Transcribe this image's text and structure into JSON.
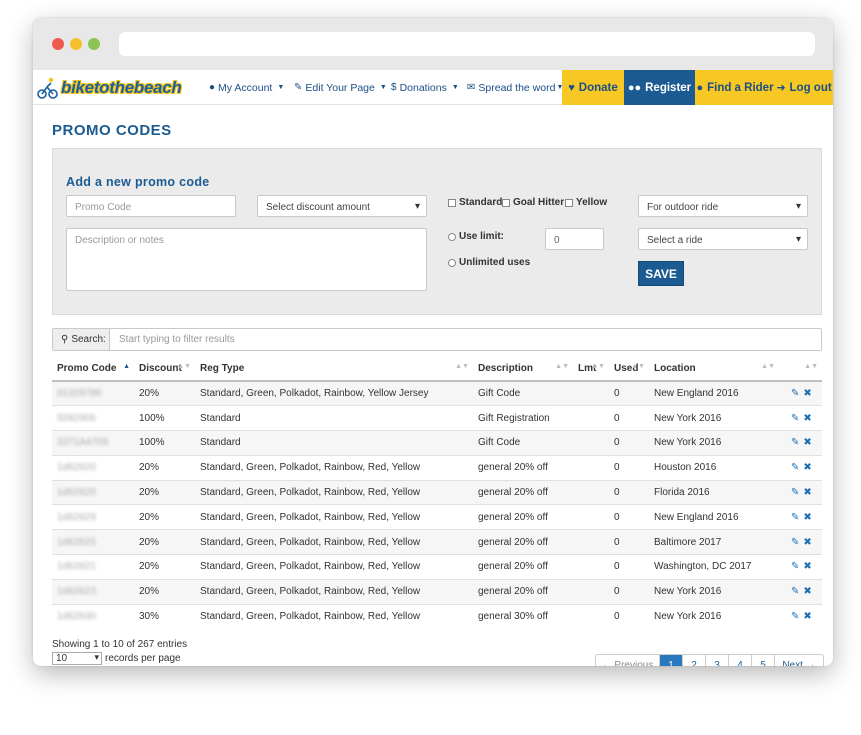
{
  "nav": {
    "logo_text": "biketothebeach",
    "menu": [
      {
        "label": "My Account",
        "icon": "user-icon"
      },
      {
        "label": "Edit Your Page",
        "icon": "edit-icon"
      },
      {
        "label": "Donations",
        "icon": "dollar-icon"
      },
      {
        "label": "Spread the word",
        "icon": "envelope-icon"
      }
    ],
    "donate_label": "Donate",
    "register_label": "Register",
    "find_rider_label": "Find a Rider",
    "logout_label": "Log out",
    "colors": {
      "brand_blue": "#1b5b92",
      "accent_yellow": "#f7c723"
    }
  },
  "page": {
    "title": "PROMO CODES"
  },
  "form": {
    "title": "Add a new promo code",
    "promo_placeholder": "Promo Code",
    "discount_select": "Select discount amount",
    "description_placeholder": "Description or notes",
    "checkbox_standard": "Standard",
    "checkbox_goal": "Goal Hitter",
    "checkbox_yellow": "Yellow",
    "use_limit_label": "Use limit:",
    "use_limit_value": "0",
    "unlimited_label": "Unlimited uses",
    "ride_type_select": "For outdoor ride",
    "ride_select": "Select a ride",
    "save_label": "SAVE"
  },
  "search": {
    "label": "Search:",
    "placeholder": "Start typing to filter results"
  },
  "table": {
    "headers": [
      "Promo Code",
      "Discount",
      "Reg Type",
      "Description",
      "Lmt",
      "Used",
      "Location"
    ],
    "rows": [
      {
        "code": "01329786",
        "discount": "20%",
        "reg_type": "Standard, Green, Polkadot, Rainbow, Yellow Jersey",
        "description": "Gift Code",
        "lmt": "",
        "used": "0",
        "location": "New England 2016"
      },
      {
        "code": "5092906",
        "discount": "100%",
        "reg_type": "Standard",
        "description": "Gift Registration",
        "lmt": "",
        "used": "0",
        "location": "New York 2016"
      },
      {
        "code": "3371A4709",
        "discount": "100%",
        "reg_type": "Standard",
        "description": "Gift Code",
        "lmt": "",
        "used": "0",
        "location": "New York 2016"
      },
      {
        "code": "1d62620",
        "discount": "20%",
        "reg_type": "Standard, Green, Polkadot, Rainbow, Red, Yellow",
        "description": "general 20% off",
        "lmt": "",
        "used": "0",
        "location": "Houston 2016"
      },
      {
        "code": "1d62620",
        "discount": "20%",
        "reg_type": "Standard, Green, Polkadot, Rainbow, Red, Yellow",
        "description": "general 20% off",
        "lmt": "",
        "used": "0",
        "location": "Florida 2016"
      },
      {
        "code": "1d62629",
        "discount": "20%",
        "reg_type": "Standard, Green, Polkadot, Rainbow, Red, Yellow",
        "description": "general 20% off",
        "lmt": "",
        "used": "0",
        "location": "New England 2016"
      },
      {
        "code": "1d62625",
        "discount": "20%",
        "reg_type": "Standard, Green, Polkadot, Rainbow, Red, Yellow",
        "description": "general 20% off",
        "lmt": "",
        "used": "0",
        "location": "Baltimore 2017"
      },
      {
        "code": "1d62621",
        "discount": "20%",
        "reg_type": "Standard, Green, Polkadot, Rainbow, Red, Yellow",
        "description": "general 20% off",
        "lmt": "",
        "used": "0",
        "location": "Washington, DC 2017"
      },
      {
        "code": "1d62623",
        "discount": "20%",
        "reg_type": "Standard, Green, Polkadot, Rainbow, Red, Yellow",
        "description": "general 20% off",
        "lmt": "",
        "used": "0",
        "location": "New York 2016"
      },
      {
        "code": "1d62630",
        "discount": "30%",
        "reg_type": "Standard, Green, Polkadot, Rainbow, Red, Yellow",
        "description": "general 30% off",
        "lmt": "",
        "used": "0",
        "location": "New York 2016"
      }
    ]
  },
  "footer": {
    "info": "Showing 1 to 10 of 267 entries",
    "per_page_value": "10",
    "per_page_label": "records per page"
  },
  "pagination": {
    "prev": "← Previous",
    "pages": [
      "1",
      "2",
      "3",
      "4",
      "5"
    ],
    "next": "Next →",
    "current": "1"
  }
}
